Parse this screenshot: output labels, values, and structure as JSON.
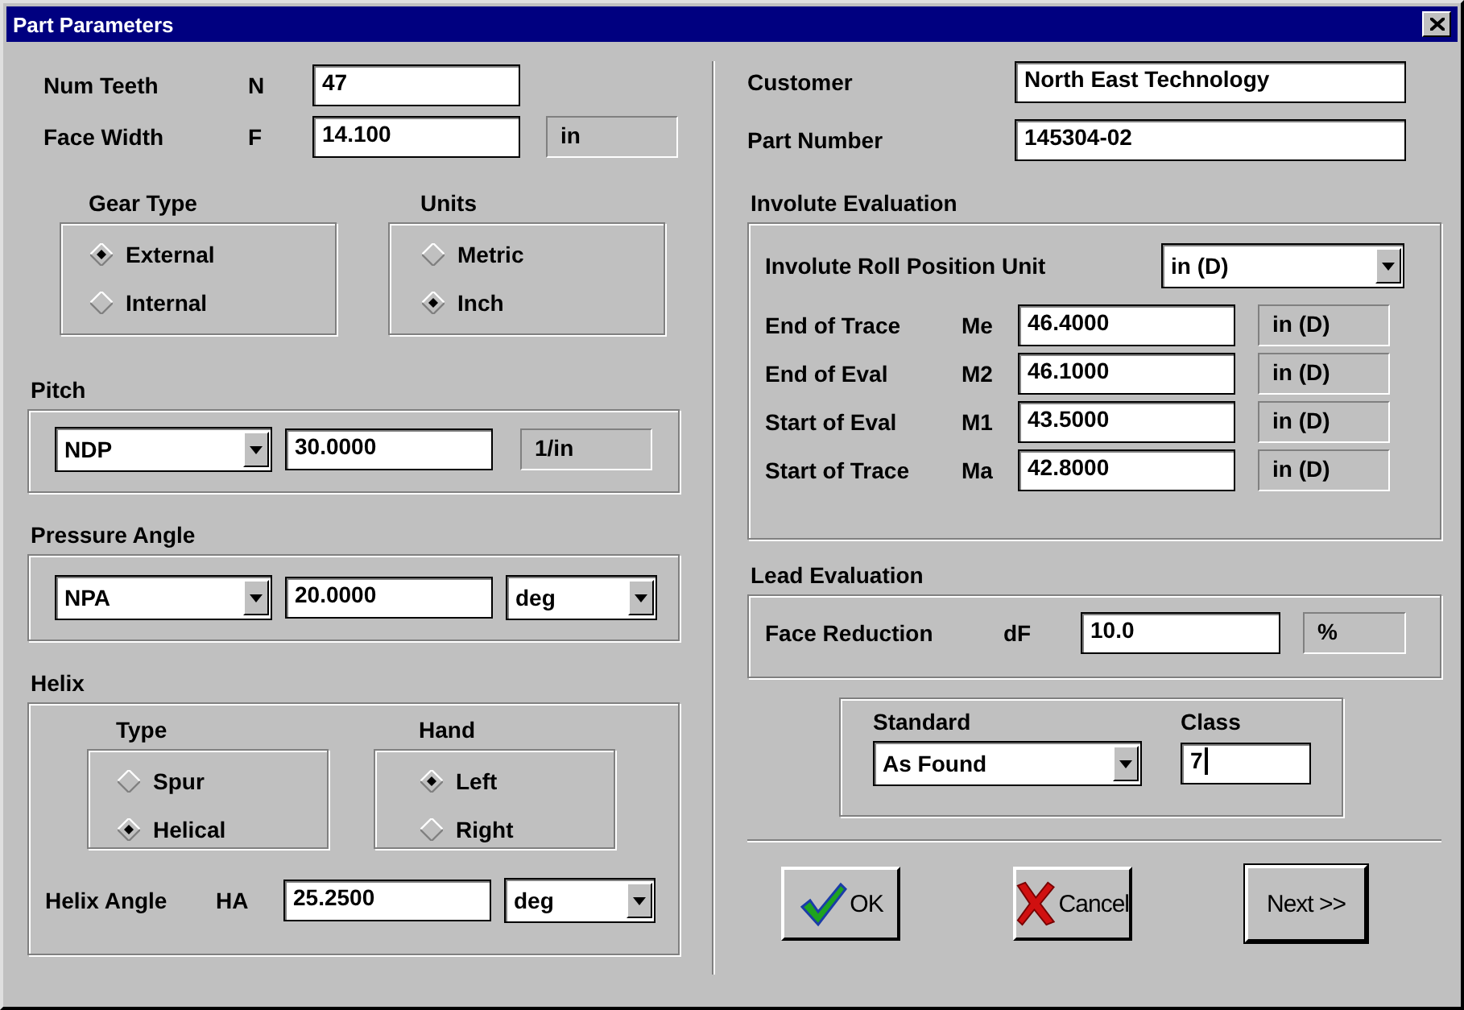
{
  "window": {
    "title": "Part Parameters"
  },
  "gear": {
    "fields": [
      {
        "label": "Num Teeth",
        "symbol": "N",
        "value": "47"
      },
      {
        "label": "Face Width",
        "symbol": "F",
        "value": "14.100",
        "unit": "in"
      }
    ],
    "gear_type": {
      "title": "Gear Type",
      "options": [
        {
          "label": "External",
          "selected": true
        },
        {
          "label": "Internal",
          "selected": false
        }
      ]
    },
    "units": {
      "title": "Units",
      "options": [
        {
          "label": "Metric",
          "selected": false
        },
        {
          "label": "Inch",
          "selected": true
        }
      ]
    }
  },
  "pitch": {
    "title": "Pitch",
    "type": "NDP",
    "value": "30.0000",
    "unit": {
      "kind": "label",
      "text": "1/in"
    }
  },
  "pressure_angle": {
    "title": "Pressure Angle",
    "type": "NPA",
    "value": "20.0000",
    "unit": {
      "kind": "select",
      "text": "deg"
    }
  },
  "helix": {
    "title": "Helix",
    "type": {
      "title": "Type",
      "options": [
        {
          "label": "Spur",
          "selected": false
        },
        {
          "label": "Helical",
          "selected": true
        }
      ]
    },
    "hand": {
      "title": "Hand",
      "options": [
        {
          "label": "Left",
          "selected": true
        },
        {
          "label": "Right",
          "selected": false
        }
      ]
    },
    "angle": {
      "label": "Helix Angle",
      "symbol": "HA",
      "value": "25.2500",
      "unit": {
        "kind": "select",
        "text": "deg"
      }
    }
  },
  "customer": {
    "label": "Customer",
    "value": "North East Technology"
  },
  "part_number": {
    "label": "Part Number",
    "value": "145304-02"
  },
  "involute": {
    "title": "Involute Evaluation",
    "roll_unit_label": "Involute Roll Position Unit",
    "roll_unit": "in (D)",
    "rows": [
      {
        "label": "End of Trace",
        "symbol": "Me",
        "value": "46.4000",
        "unit": "in (D)"
      },
      {
        "label": "End of Eval",
        "symbol": "M2",
        "value": "46.1000",
        "unit": "in (D)"
      },
      {
        "label": "Start of Eval",
        "symbol": "M1",
        "value": "43.5000",
        "unit": "in (D)"
      },
      {
        "label": "Start of Trace",
        "symbol": "Ma",
        "value": "42.8000",
        "unit": "in (D)"
      }
    ]
  },
  "lead": {
    "title": "Lead Evaluation",
    "label": "Face Reduction",
    "symbol": "dF",
    "value": "10.0",
    "unit": "%"
  },
  "standard": {
    "label": "Standard",
    "value": "As Found",
    "class_label": "Class",
    "class_value": "7",
    "class_focused": true
  },
  "buttons": [
    {
      "label": "OK",
      "kind": "ok",
      "default": false
    },
    {
      "label": "Cancel",
      "kind": "cancel",
      "default": false
    },
    {
      "label": "Next >>",
      "kind": "next",
      "default": true
    }
  ]
}
